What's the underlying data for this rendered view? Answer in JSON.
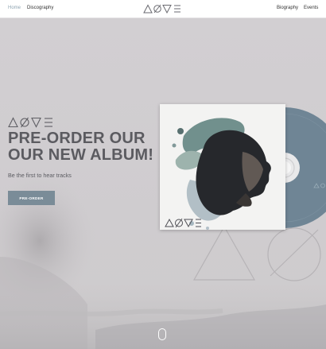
{
  "nav": {
    "left": [
      "Home",
      "Discography"
    ],
    "right": [
      "Biography",
      "Events"
    ]
  },
  "hero": {
    "title_line1": "PRE-ORDER OUR",
    "title_line2": "OUR NEW ALBUM!",
    "subtitle": "Be the first to hear tracks",
    "button_label": "PRE-ORDER"
  },
  "colors": {
    "background": "#d3d0d2",
    "nav_active": "#8fa5b2",
    "title": "#5b5b60",
    "button": "#7a8c98",
    "disc": "#6f8595"
  },
  "icons": [
    "triangle-icon",
    "slashed-circle-icon",
    "inverted-triangle-icon",
    "triple-bar-icon",
    "mouse-scroll-icon"
  ]
}
